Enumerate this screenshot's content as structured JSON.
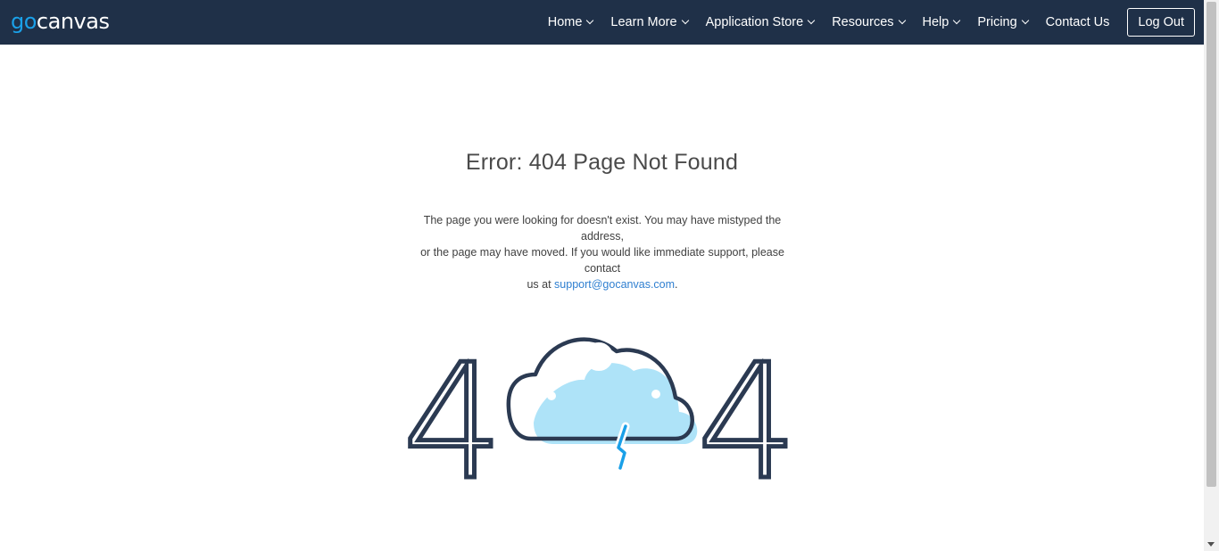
{
  "header": {
    "logo": {
      "part1": "go",
      "part2": "canvas"
    },
    "nav": [
      {
        "label": "Home",
        "has_dropdown": true
      },
      {
        "label": "Learn More",
        "has_dropdown": true
      },
      {
        "label": "Application Store",
        "has_dropdown": true
      },
      {
        "label": "Resources",
        "has_dropdown": true
      },
      {
        "label": "Help",
        "has_dropdown": true
      },
      {
        "label": "Pricing",
        "has_dropdown": true
      },
      {
        "label": "Contact Us",
        "has_dropdown": false
      }
    ],
    "logout_label": "Log Out"
  },
  "main": {
    "title": "Error: 404 Page Not Found",
    "message": {
      "line1": "The page you were looking for doesn't exist. You may have mistyped the address,",
      "line2": "or the page may have moved. If you would like immediate support, please contact",
      "line3_prefix": "us at ",
      "email": "support@gocanvas.com",
      "line3_suffix": "."
    },
    "illustration": {
      "digit_left": "4",
      "digit_right": "4",
      "icon": "cloud-lightning-icon"
    }
  },
  "colors": {
    "header_bg": "#1f3048",
    "logo_accent": "#1aa0e8",
    "link": "#2f7fd0",
    "cloud_fill": "#aee3f8",
    "art_stroke": "#2b3a52",
    "lightning": "#1aa0e8"
  }
}
